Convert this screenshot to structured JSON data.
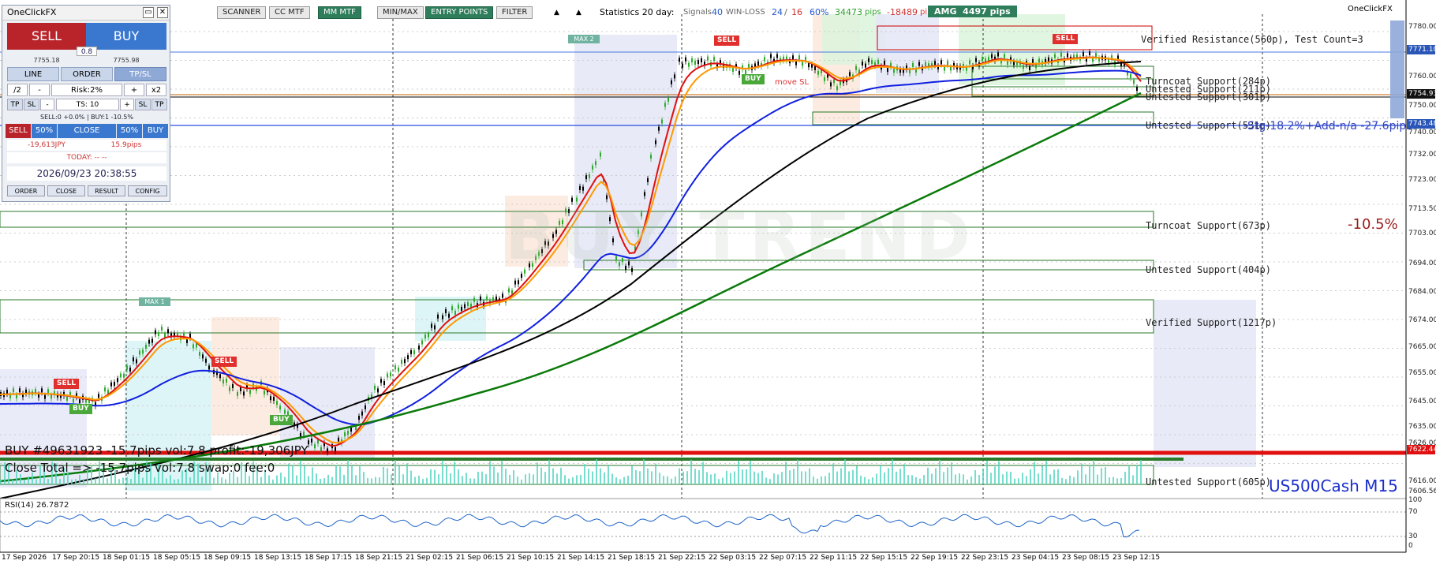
{
  "toolbar": {
    "buttons": [
      {
        "label": "SCANNER",
        "on": false
      },
      {
        "label": "CC MTF",
        "on": false
      },
      {
        "label": "MM MTF",
        "on": true
      },
      {
        "label": "MIN/MAX",
        "on": false
      },
      {
        "label": "ENTRY POINTS",
        "on": true
      },
      {
        "label": "FILTER",
        "on": false
      }
    ],
    "arrow_up": "▲",
    "arrow_down": "▲"
  },
  "stats": {
    "label": "Statistics 20 day:",
    "signals_label": "Signals",
    "signals": "40",
    "winloss_label": "WIN-LOSS",
    "win": "24",
    "loss": "16",
    "pct": "60%",
    "pips_plus": "34473",
    "pips_word": "pips",
    "pips_minus": "-18489",
    "pips_word2": "pips",
    "amg_label": "AMG",
    "amg_value": "4497 pips"
  },
  "brand": "OneClickFX",
  "panel": {
    "title": "OneClickFX",
    "sell": "SELL",
    "buy": "BUY",
    "spread": "0.8",
    "bid": "7755.18",
    "ask": "7755.98",
    "tabs": [
      "LINE",
      "ORDER",
      "TP/SL"
    ],
    "half": "/2",
    "minus": "-",
    "risk": "Risk:2%",
    "plus": "+",
    "x2": "x2",
    "tp": "TP",
    "sl": "SL",
    "ts": "TS: 10",
    "summary": "SELL:0 +0.0% | BUY:1 -10.5%",
    "row_sell": "SELL",
    "row_50a": "50%",
    "row_close": "CLOSE",
    "row_50b": "50%",
    "row_buy": "BUY",
    "pnl_money": "-19,613JPY",
    "pnl_pips": "15.9pips",
    "today": "TODAY: -- --",
    "datetime": "2026/09/23  20:38:55",
    "footer": [
      "ORDER",
      "CLOSE",
      "RESULT",
      "CONFIG"
    ]
  },
  "zones": [
    {
      "label": "Verified Resistance(560p), Test Count=3",
      "color": "#c00"
    },
    {
      "label": "Turncoat Support(284p)",
      "color": "#2a7a2a"
    },
    {
      "label": "Untested Support(211p)",
      "color": "#2a7a2a"
    },
    {
      "label": "Untested Support(301p)",
      "color": "#2a7a2a"
    },
    {
      "label": "Untested Support(531p)",
      "color": "#2a7a2a"
    },
    {
      "label": "Turncoat Support(673p)",
      "color": "#2a7a2a"
    },
    {
      "label": "Untested Support(404p)",
      "color": "#2a7a2a"
    },
    {
      "label": "Verified Support(1217p)",
      "color": "#2a7a2a"
    },
    {
      "label": "Untested Support(605p)",
      "color": "#2a7a2a"
    }
  ],
  "overlay": {
    "sl_text": "-Stg-18.2%+Add-n/a -27.6pips",
    "big_pct": "-10.5%",
    "symbol": "US500Cash M15",
    "trend_text": "BUY TREND",
    "position_line": "BUY #49631923 -15.7pips vol:7.8 profit:-19,306JPY",
    "close_total": "Close Total => -15.7pips vol:7.8 swap:0 fee:0",
    "rsi_label": "RSI(14) 26.7872",
    "max1": "MAX 1",
    "max2": "MAX 2",
    "move_sl": "move SL"
  },
  "signals": [
    {
      "type": "SELL",
      "color": "#e0302e"
    },
    {
      "type": "BUY",
      "color": "#4aa83a"
    },
    {
      "type": "SELL",
      "color": "#e0302e"
    },
    {
      "type": "BUY",
      "color": "#4aa83a"
    },
    {
      "type": "SELL",
      "color": "#e0302e"
    },
    {
      "type": "BUY",
      "color": "#4aa83a"
    },
    {
      "type": "SELL",
      "color": "#e0302e"
    }
  ],
  "price_axis": [
    "7780.00",
    "7771.10",
    "7760.00",
    "7754.93",
    "7750.00",
    "7743.48",
    "7740.00",
    "7732.00",
    "7723.00",
    "7713.50",
    "7703.00",
    "7694.00",
    "7684.00",
    "7674.00",
    "7665.00",
    "7655.00",
    "7645.00",
    "7635.00",
    "7626.00",
    "7622.44",
    "7616.00",
    "7606.56"
  ],
  "rsi_axis": [
    "100",
    "70",
    "30",
    "0"
  ],
  "time_axis": [
    "17 Sep 2026",
    "17 Sep 20:15",
    "18 Sep 01:15",
    "18 Sep 05:15",
    "18 Sep 09:15",
    "18 Sep 13:15",
    "18 Sep 17:15",
    "18 Sep 21:15",
    "21 Sep 02:15",
    "21 Sep 06:15",
    "21 Sep 10:15",
    "21 Sep 14:15",
    "21 Sep 18:15",
    "21 Sep 22:15",
    "22 Sep 03:15",
    "22 Sep 07:15",
    "22 Sep 11:15",
    "22 Sep 15:15",
    "22 Sep 19:15",
    "22 Sep 23:15",
    "23 Sep 04:15",
    "23 Sep 08:15",
    "23 Sep 12:15"
  ],
  "colors": {
    "ma_red": "#e01010",
    "ma_orange": "#ff9900",
    "ma_blue": "#1020e0",
    "ma_black": "#000000",
    "ma_green": "#0a7a0a",
    "candle_up": "#2eaa2e",
    "candle_down": "#000000",
    "sell": "#c0282a",
    "buy": "#3a78d0"
  }
}
